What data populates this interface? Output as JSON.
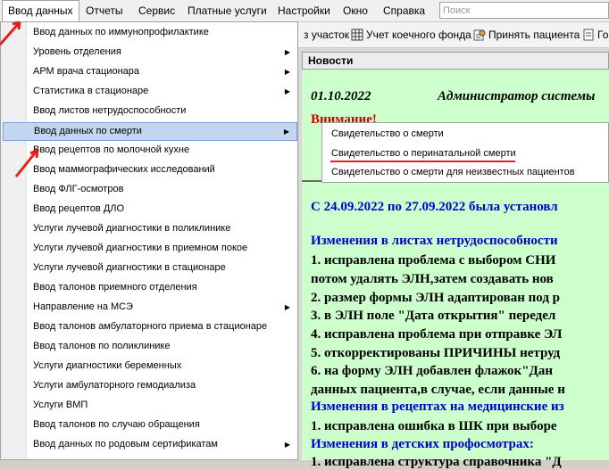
{
  "menubar": {
    "items": [
      "Ввод данных",
      "Отчеты",
      "Сервис",
      "Платные услуги",
      "Настройки",
      "Окно",
      "Справка"
    ]
  },
  "search": {
    "placeholder": "Поиск"
  },
  "toolbar": {
    "items": [
      "з участок",
      "Учет коечного фонда",
      "Принять пациента",
      "Го"
    ]
  },
  "main_menu": {
    "items": [
      {
        "label": "Ввод данных по иммунопрофилактике",
        "has_submenu": false
      },
      {
        "label": "Уровень отделения",
        "has_submenu": true
      },
      {
        "label": "АРМ врача стационара",
        "has_submenu": true
      },
      {
        "label": "Статистика в стационаре",
        "has_submenu": true
      },
      {
        "label": "Ввод листов нетрудоспособности",
        "has_submenu": false
      },
      {
        "label": "Ввод данных по смерти",
        "has_submenu": true,
        "highlighted": true
      },
      {
        "label": "Ввод рецептов по молочной кухне",
        "has_submenu": false
      },
      {
        "label": "Ввод маммографических исследований",
        "has_submenu": false
      },
      {
        "label": "Ввод ФЛГ-осмотров",
        "has_submenu": false
      },
      {
        "label": "Ввод рецептов ДЛО",
        "has_submenu": false
      },
      {
        "label": "Услуги лучевой диагностики в поликлинике",
        "has_submenu": false
      },
      {
        "label": "Услуги лучевой диагностики в приемном покое",
        "has_submenu": false
      },
      {
        "label": "Услуги лучевой диагностики в стационаре",
        "has_submenu": false
      },
      {
        "label": "Ввод талонов приемного отделения",
        "has_submenu": false
      },
      {
        "label": "Направление на МСЭ",
        "has_submenu": true
      },
      {
        "label": "Ввод талонов амбулаторного приема в стационаре",
        "has_submenu": false
      },
      {
        "label": "Ввод талонов по поликлинике",
        "has_submenu": false
      },
      {
        "label": "Услуги диагностики беременных",
        "has_submenu": false
      },
      {
        "label": "Услуги амбулаторного гемодиализа",
        "has_submenu": false
      },
      {
        "label": "Услуги ВМП",
        "has_submenu": false
      },
      {
        "label": "Ввод талонов по случаю обращения",
        "has_submenu": false
      },
      {
        "label": "Ввод данных по родовым сертификатам",
        "has_submenu": true
      }
    ]
  },
  "submenu": {
    "items": [
      "Свидетельство о смерти",
      "Свидетельство о перинатальной смерти",
      "Свидетельство о смерти для неизвестных пациентов"
    ]
  },
  "news": {
    "tab_title": "Новости",
    "date": "01.10.2022",
    "author": "Администратор системы",
    "warning": "Внимание!",
    "lines": [
      {
        "text": "С 24.09.2022 по 27.09.2022 была установл",
        "color": "blue"
      },
      {
        "text": "Изменения в листах нетрудоспособности",
        "color": "blue"
      },
      {
        "text": "1. исправлена проблема с выбором СНИ",
        "color": "black"
      },
      {
        "text": "потом удалять ЭЛН,затем создавать нов",
        "color": "black"
      },
      {
        "text": "2. размер формы ЭЛН адаптирован под р",
        "color": "black"
      },
      {
        "text": "3. в ЭЛН поле \"Дата открытия\" передел",
        "color": "black"
      },
      {
        "text": "4. исправлена проблема при отправке ЭЛ",
        "color": "black"
      },
      {
        "text": "5. откорректированы ПРИЧИНЫ нетруд",
        "color": "black"
      },
      {
        "text": "6. на форму ЭЛН добавлен флажок\"Дан",
        "color": "black"
      },
      {
        "text": "данных пациента,в случае, если данные н",
        "color": "black"
      },
      {
        "text": "Изменения в рецептах на медицинские из",
        "color": "blue"
      },
      {
        "text": "1. исправлена ошибка в ШК при выборе",
        "color": "black"
      },
      {
        "text": "Изменения в детских профосмотрах:",
        "color": "blue"
      },
      {
        "text": "1. исправлена структура справочника \"Д",
        "color": "black"
      }
    ]
  },
  "colors": {
    "news_bg": "#ccffcc",
    "warning": "#cc0000",
    "heading_blue": "#0000cc",
    "highlight_bg": "#c2d6f0",
    "annotation_red": "#e02020"
  }
}
